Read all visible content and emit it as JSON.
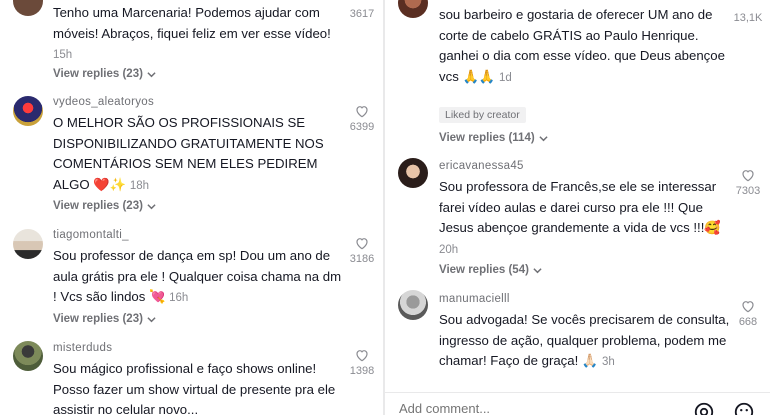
{
  "left_comments": [
    {
      "username": "",
      "text": "Tenho uma Marcenaria! Podemos ajudar com móveis! Abraços, fiquei feliz em ver esse vídeo!",
      "time": "15h",
      "likes": "3617",
      "replies": "View replies (23)"
    },
    {
      "username": "vydeos_aleatoryos",
      "text": "O MELHOR SÃO OS PROFISSIONAIS SE DISPONIBILIZANDO GRATUITAMENTE NOS COMENTÁRIOS SEM NEM ELES PEDIREM ALGO ❤️✨",
      "time": "18h",
      "likes": "6399",
      "replies": "View replies (23)"
    },
    {
      "username": "tiagomontalti_",
      "text": "Sou professor de dança em sp! Dou um ano de aula grátis pra ele ! Qualquer coisa chama na dm ! Vcs são lindos 💘",
      "time": "16h",
      "likes": "3186",
      "replies": "View replies (23)"
    },
    {
      "username": "misterduds",
      "text": "Sou mágico profissional e faço shows online! Posso fazer um show virtual de presente pra ele assistir no celular novo...",
      "time": "",
      "likes": "1398",
      "replies": ""
    }
  ],
  "right_comments": [
    {
      "username": "",
      "text": "sou barbeiro e gostaria de oferecer UM ano de corte de cabelo GRÁTIS ao Paulo Henrique. ganhei o dia com esse vídeo. que Deus abençoe vcs 🙏🙏",
      "time": "1d",
      "likes": "13,1K",
      "liked_by": "Liked by creator",
      "replies": "View replies (114)"
    },
    {
      "username": "ericavanessa45",
      "text": "Sou professora de Francês,se ele se interessar farei vídeo aulas e darei curso pra ele !!! Que Jesus abençoe grandemente a vida de vcs !!!🥰",
      "time": "20h",
      "likes": "7303",
      "replies": "View replies (54)"
    },
    {
      "username": "manumacielll",
      "text": "Sou advogada! Se vocês precisarem de consulta, ingresso de ação, qualquer problema, podem me chamar! Faço de graça! 🙏🏻",
      "time": "3h",
      "likes": "668",
      "replies": ""
    }
  ],
  "add_comment": {
    "placeholder": "Add comment..."
  },
  "icons": {
    "like": "heart-outline-icon",
    "replies": "chevron-down-icon",
    "mention": "at-sign-icon",
    "emoji": "emoji-icon"
  },
  "colors": {
    "text": "#161823",
    "muted": "#8a8b91"
  }
}
